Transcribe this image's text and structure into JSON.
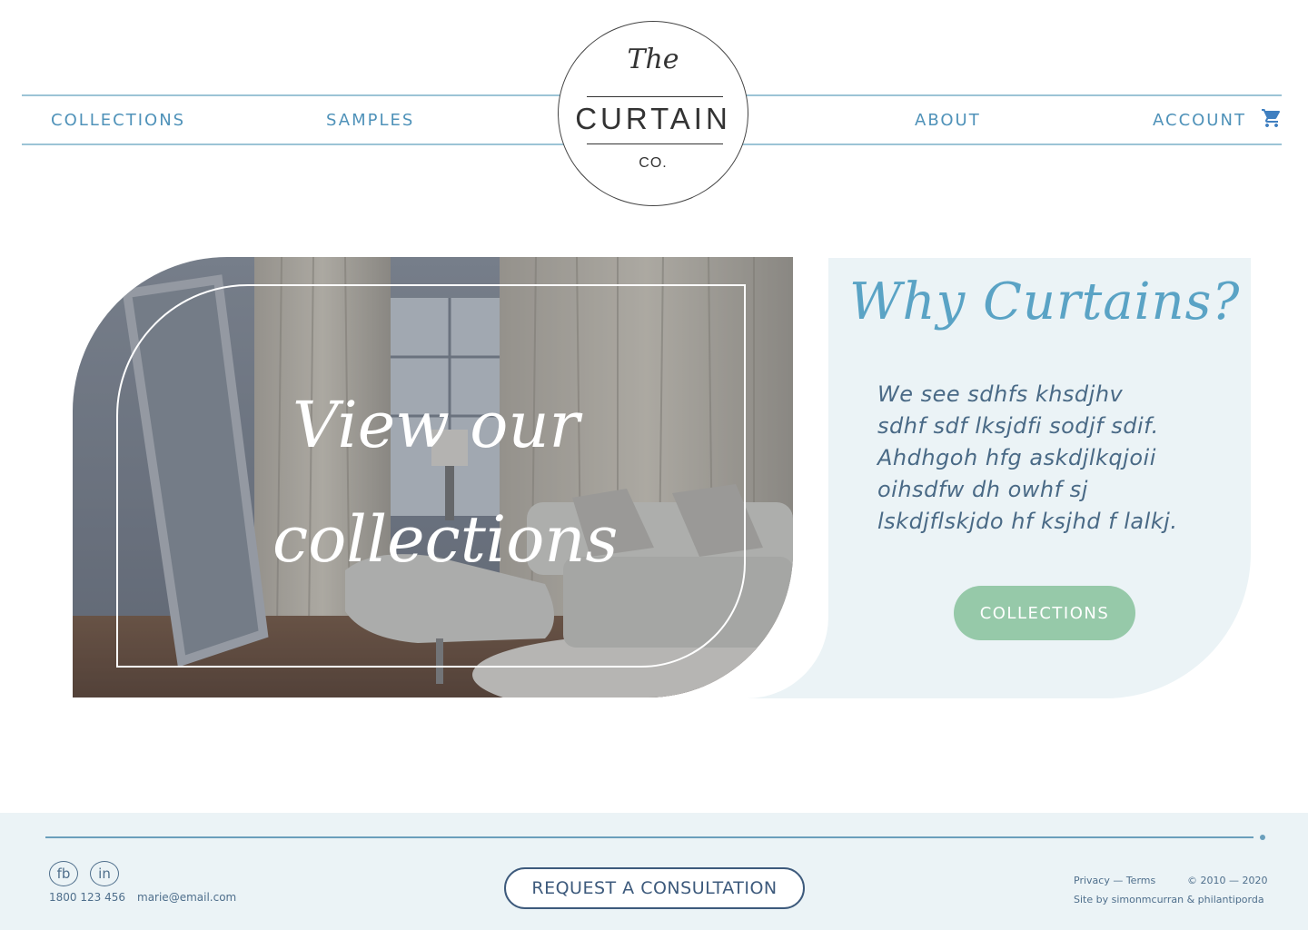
{
  "header": {
    "nav": {
      "collections": "COLLECTIONS",
      "samples": "SAMPLES",
      "about": "ABOUT",
      "account": "ACCOUNT"
    },
    "logo": {
      "the": "The",
      "name": "CURTAIN",
      "suffix": "CO."
    },
    "cart_icon": "shopping-cart-icon"
  },
  "hero": {
    "title_line1": "View our",
    "title_line2": "collections",
    "why_title": "Why Curtains?",
    "why_lines": [
      "We see sdhfs khsdjhv",
      "sdhf sdf lksjdfi  sodjf sdif.",
      "Ahdhgoh hfg  askdjlkqjoii",
      "oihsdfw  dh  owhf sj",
      "lskdjflskjdo hf  ksjhd f lalkj."
    ],
    "button_label": "COLLECTIONS"
  },
  "footer": {
    "social": {
      "fb": "fb",
      "in": "in"
    },
    "phone": "1800 123 456",
    "email": "marie@email.com",
    "consult_label": "REQUEST A CONSULTATION",
    "legal": "Privacy — Terms",
    "copyright": "© 2010 — 2020",
    "credit": "Site by simonmcurran & philantiporda"
  },
  "colors": {
    "nav_text": "#4f92b9",
    "accent_green": "#96c9a9",
    "panel_bg": "#ebf3f6",
    "footer_text": "#4f6f8c"
  }
}
